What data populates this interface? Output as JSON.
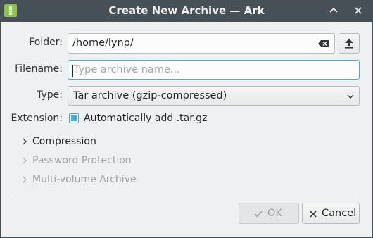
{
  "window": {
    "title": "Create New Archive — Ark"
  },
  "titlebar": {
    "app_icon": "archive-app-icon",
    "keep_above_icon": "chevron-up-icon",
    "close_icon": "close-icon"
  },
  "form": {
    "folder": {
      "label": "Folder:",
      "value": "/home/lynp/",
      "clear_icon": "clear-text-icon",
      "browse_icon": "folder-up-icon"
    },
    "filename": {
      "label": "Filename:",
      "value": "",
      "placeholder": "Type archive name..."
    },
    "type": {
      "label": "Type:",
      "selected": "Tar archive (gzip-compressed)",
      "dropdown_icon": "chevron-down-icon"
    },
    "extension": {
      "label": "Extension:",
      "checkbox_label": "Automatically add .tar.gz",
      "checked": true
    }
  },
  "sections": [
    {
      "label": "Compression",
      "enabled": true
    },
    {
      "label": "Password Protection",
      "enabled": false
    },
    {
      "label": "Multi-volume Archive",
      "enabled": false
    }
  ],
  "buttons": {
    "ok": {
      "label": "OK",
      "enabled": false,
      "icon": "checkmark-icon"
    },
    "cancel": {
      "label": "Cancel",
      "enabled": true,
      "icon": "cancel-icon"
    }
  },
  "colors": {
    "accent": "#3daee9",
    "titlebar": "#475057",
    "window_bg": "#eff0f1"
  }
}
